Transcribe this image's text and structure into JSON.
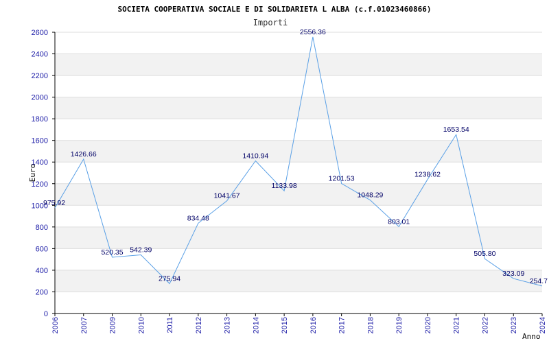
{
  "colors": {
    "line": "#5aa0e6",
    "band": "#f2f2f2",
    "grid": "#dddddd",
    "axis": "#000000",
    "tick_text": "#1a1aa6",
    "label_text": "#000066"
  },
  "chart_data": {
    "type": "line",
    "title": "SOCIETA COOPERATIVA SOCIALE E DI SOLIDARIETA L ALBA (c.f.01023460866)",
    "subtitle": "Importi",
    "xlabel": "Anno",
    "ylabel": "Euro",
    "ylim": [
      0,
      2600
    ],
    "yticks": [
      "0",
      "200",
      "400",
      "600",
      "800",
      "1000",
      "1200",
      "1400",
      "1600",
      "1800",
      "2000",
      "2200",
      "2400",
      "2600"
    ],
    "grid": true,
    "categories": [
      "2006",
      "2007",
      "2009",
      "2010",
      "2011",
      "2012",
      "2013",
      "2014",
      "2015",
      "2016",
      "2017",
      "2018",
      "2019",
      "2020",
      "2021",
      "2022",
      "2023",
      "2024"
    ],
    "values": [
      975.92,
      1426.66,
      520.35,
      542.39,
      275.94,
      834.48,
      1041.67,
      1410.94,
      1133.98,
      2556.36,
      1201.53,
      1048.29,
      803.01,
      1238.62,
      1653.54,
      505.8,
      323.09,
      254.7
    ],
    "value_labels": [
      "975.92",
      "1426.66",
      "520.35",
      "542.39",
      "275.94",
      "834.48",
      "1041.67",
      "1410.94",
      "1133.98",
      "2556.36",
      "1201.53",
      "1048.29",
      "803.01",
      "1238.62",
      "1653.54",
      "505.80",
      "323.09",
      "254.7"
    ]
  }
}
